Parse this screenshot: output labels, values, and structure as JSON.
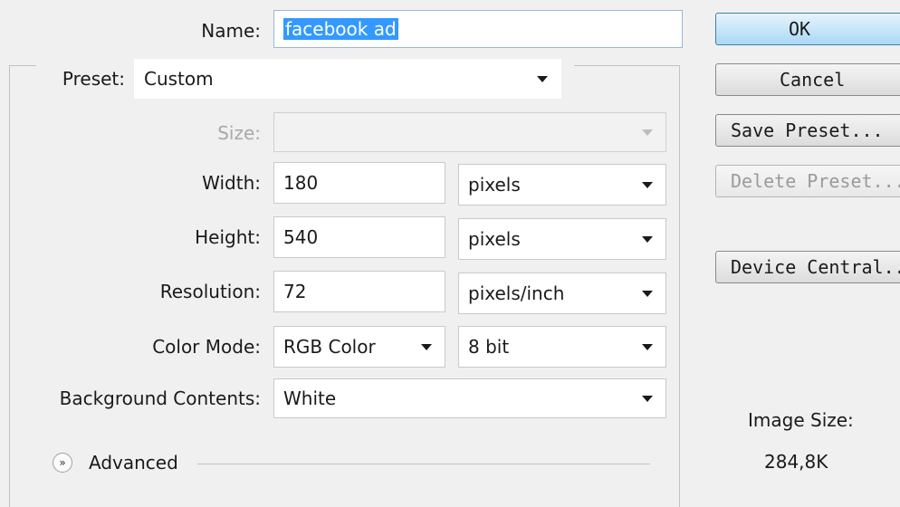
{
  "dialog": {
    "name_label": "Name:",
    "name_value": "facebook ad",
    "preset_label": "Preset:",
    "preset_value": "Custom",
    "size_label": "Size:",
    "size_value": "",
    "width_label": "Width:",
    "width_value": "180",
    "width_unit": "pixels",
    "height_label": "Height:",
    "height_value": "540",
    "height_unit": "pixels",
    "resolution_label": "Resolution:",
    "resolution_value": "72",
    "resolution_unit": "pixels/inch",
    "color_mode_label": "Color Mode:",
    "color_mode_value": "RGB Color",
    "bit_depth_value": "8 bit",
    "background_label": "Background Contents:",
    "background_value": "White",
    "advanced_label": "Advanced"
  },
  "buttons": {
    "ok": "OK",
    "cancel": "Cancel",
    "save_preset": "Save Preset...",
    "delete_preset": "Delete Preset...",
    "device_central": "Device Central..."
  },
  "image_size": {
    "label": "Image Size:",
    "value": "284,8K"
  },
  "icons": {
    "dropdown": "chevron-down-icon",
    "advanced_toggle": "double-chevron-down-icon"
  },
  "colors": {
    "selection": "#3399ff",
    "ok_button": "#a9d9f5"
  }
}
